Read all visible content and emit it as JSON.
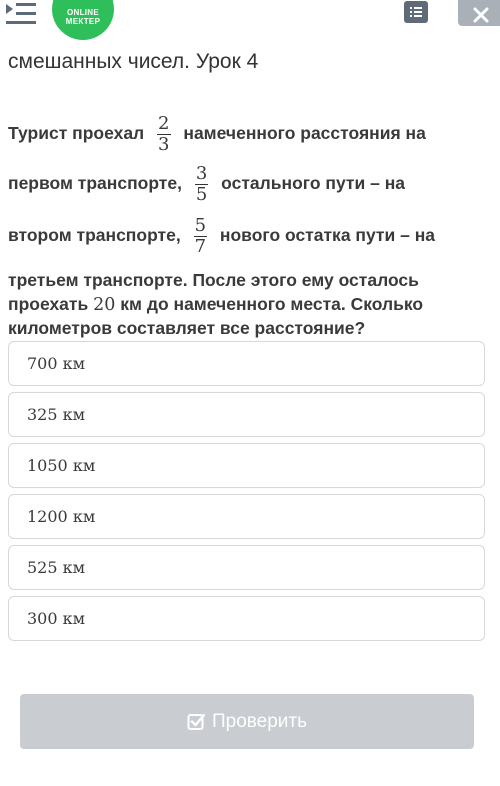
{
  "header": {
    "logo_line1": "ONLINE",
    "logo_line2": "МЕКТЕР",
    "icons": [
      "menu-icon",
      "list-icon",
      "close-icon"
    ]
  },
  "lesson": {
    "title": "смешанных чисел. Урок 4"
  },
  "question": {
    "line1_a": "Турист проехал",
    "frac1_num": "2",
    "frac1_den": "3",
    "line1_b": "намеченного расстояния на",
    "line2_a": "первом транспорте,",
    "frac2_num": "3",
    "frac2_den": "5",
    "line2_b": "остального пути – на",
    "line3_a": "втором транспорте,",
    "frac3_num": "5",
    "frac3_den": "7",
    "line3_b": "нового остатка пути – на",
    "line4": "третьем транспорте. После этого ему осталось",
    "line5_a": "проехать",
    "line5_num": "20",
    "line5_b": "км до намеченного места. Сколько",
    "line6": "километров составляет все расстояние?"
  },
  "options": [
    {
      "value": "700",
      "unit": "км"
    },
    {
      "value": "325",
      "unit": "км"
    },
    {
      "value": "1050",
      "unit": "км"
    },
    {
      "value": "1200",
      "unit": "км"
    },
    {
      "value": "525",
      "unit": "км"
    },
    {
      "value": "300",
      "unit": "км"
    }
  ],
  "submit": {
    "label": "Проверить",
    "icon": "checkbox-icon"
  },
  "colors": {
    "logo": "#2fbf5a",
    "submit_disabled": "#c9ccd0",
    "option_border": "#d5d8dc"
  }
}
